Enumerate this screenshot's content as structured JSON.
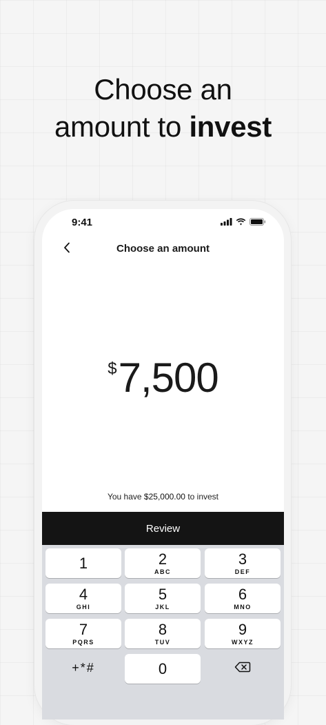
{
  "headline": {
    "line1": "Choose an",
    "line2_regular": "amount to ",
    "line2_bold": "invest"
  },
  "status_bar": {
    "time": "9:41",
    "icons": [
      "cellular-signal-icon",
      "wifi-icon",
      "battery-icon"
    ]
  },
  "nav": {
    "back_icon": "chevron-left-icon",
    "title": "Choose an amount"
  },
  "amount": {
    "currency_symbol": "$",
    "value": "7,500"
  },
  "balance_note": {
    "prefix": "You have ",
    "amount": "$25,000.00",
    "suffix": " to invest"
  },
  "review_button": {
    "label": "Review"
  },
  "keypad": {
    "keys": [
      {
        "digit": "1",
        "letters": ""
      },
      {
        "digit": "2",
        "letters": "ABC"
      },
      {
        "digit": "3",
        "letters": "DEF"
      },
      {
        "digit": "4",
        "letters": "GHI"
      },
      {
        "digit": "5",
        "letters": "JKL"
      },
      {
        "digit": "6",
        "letters": "MNO"
      },
      {
        "digit": "7",
        "letters": "PQRS"
      },
      {
        "digit": "8",
        "letters": "TUV"
      },
      {
        "digit": "9",
        "letters": "WXYZ"
      },
      {
        "digit": "0",
        "letters": ""
      }
    ],
    "symbols_label": "+*#",
    "backspace_icon": "backspace-icon"
  },
  "colors": {
    "background": "#f5f5f5",
    "review_button": "#141414",
    "keypad_background": "#d9dbe0",
    "key": "#ffffff"
  }
}
